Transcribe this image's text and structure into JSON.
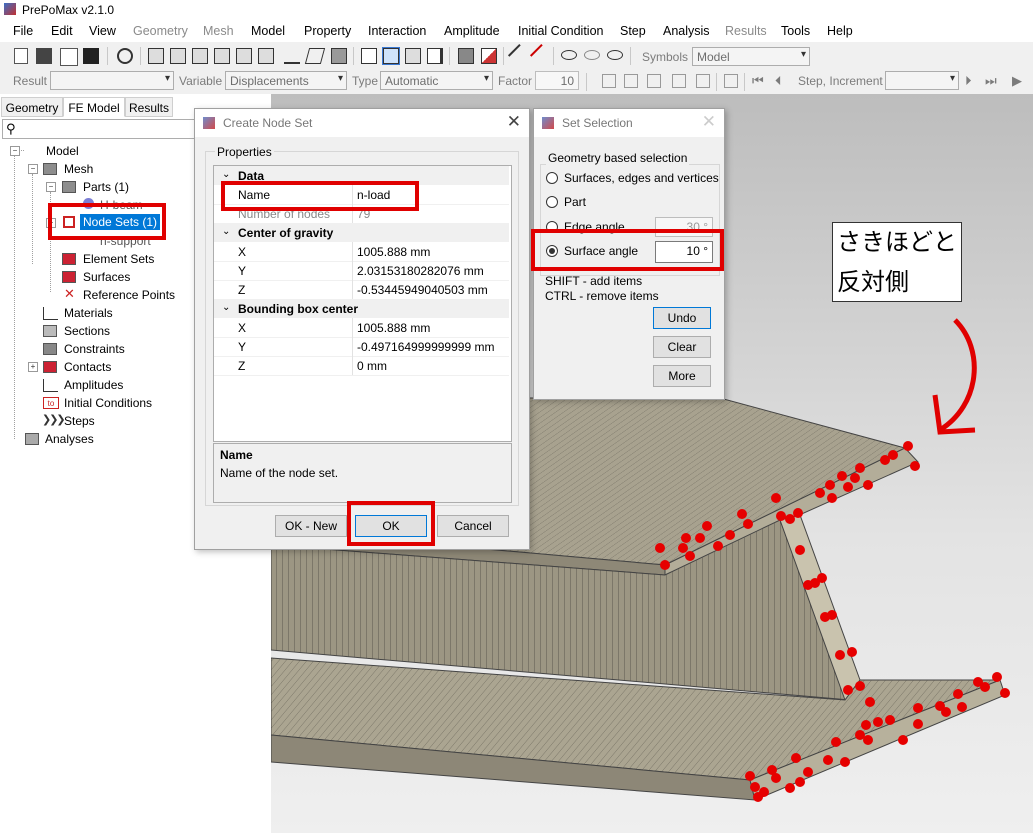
{
  "window": {
    "title": "PrePoMax v2.1.0"
  },
  "menu": [
    {
      "label": "File",
      "enabled": true
    },
    {
      "label": "Edit",
      "enabled": true
    },
    {
      "label": "View",
      "enabled": true
    },
    {
      "label": "Geometry",
      "enabled": false
    },
    {
      "label": "Mesh",
      "enabled": false
    },
    {
      "label": "Model",
      "enabled": true
    },
    {
      "label": "Property",
      "enabled": true
    },
    {
      "label": "Interaction",
      "enabled": true
    },
    {
      "label": "Amplitude",
      "enabled": true
    },
    {
      "label": "Initial Condition",
      "enabled": true
    },
    {
      "label": "Step",
      "enabled": true
    },
    {
      "label": "Analysis",
      "enabled": true
    },
    {
      "label": "Results",
      "enabled": false
    },
    {
      "label": "Tools",
      "enabled": true
    },
    {
      "label": "Help",
      "enabled": true
    }
  ],
  "toolbar1": {
    "symbols_label": "Symbols",
    "symbols_value": "Model"
  },
  "toolbar2": {
    "result_label": "Result",
    "result_value": "",
    "variable_label": "Variable",
    "variable_value": "Displacements",
    "type_label": "Type",
    "type_value": "Automatic",
    "factor_label": "Factor",
    "factor_value": "10",
    "step_label": "Step, Increment",
    "step_value": ""
  },
  "left_panel": {
    "tabs": [
      {
        "label": "Geometry",
        "active": false
      },
      {
        "label": "FE Model",
        "active": true
      },
      {
        "label": "Results",
        "active": false
      }
    ],
    "tree": {
      "model": "Model",
      "mesh": "Mesh",
      "parts": "Parts (1)",
      "hbeam": "H-beam",
      "node_sets": "Node Sets (1)",
      "n_support": "n-support",
      "element_sets": "Element Sets",
      "surfaces": "Surfaces",
      "reference_points": "Reference Points",
      "materials": "Materials",
      "sections": "Sections",
      "constraints": "Constraints",
      "contacts": "Contacts",
      "amplitudes": "Amplitudes",
      "initial_conditions": "Initial Conditions",
      "initial_conditions_icon_text": "to",
      "steps": "Steps",
      "analyses": "Analyses"
    }
  },
  "create_node_set": {
    "title": "Create Node Set",
    "group_label": "Properties",
    "cat_data": "Data",
    "name_label": "Name",
    "name_value": "n-load",
    "num_nodes_label": "Number of nodes",
    "num_nodes_value": "79",
    "cat_cog": "Center of gravity",
    "cog": [
      {
        "axis": "X",
        "value": "1005.888 mm"
      },
      {
        "axis": "Y",
        "value": "2.03153180282076 mm"
      },
      {
        "axis": "Z",
        "value": "-0.53445949040503 mm"
      }
    ],
    "cat_bbox": "Bounding box center",
    "bbox": [
      {
        "axis": "X",
        "value": "1005.888 mm"
      },
      {
        "axis": "Y",
        "value": "-0.497164999999999 mm"
      },
      {
        "axis": "Z",
        "value": "0 mm"
      }
    ],
    "desc_title": "Name",
    "desc_text": "Name of the node set.",
    "btn_ok_new": "OK - New",
    "btn_ok": "OK",
    "btn_cancel": "Cancel"
  },
  "set_selection": {
    "title": "Set Selection",
    "group_label": "Geometry based selection",
    "options": [
      {
        "label": "Surfaces, edges and vertices",
        "checked": false
      },
      {
        "label": "Part",
        "checked": false
      },
      {
        "label": "Edge angle",
        "checked": false,
        "value": "30 °"
      },
      {
        "label": "Surface angle",
        "checked": true,
        "value": "10 °"
      }
    ],
    "hint1": "SHIFT - add items",
    "hint2": "CTRL - remove items",
    "btn_undo": "Undo",
    "btn_clear": "Clear",
    "btn_more": "More"
  },
  "annotation": {
    "line1": "さきほどと",
    "line2": "反対側",
    "color": "#e00000"
  },
  "colors": {
    "highlight_box": "#e00000",
    "selection_blue": "#0078d7",
    "beam_face": "#a8a28f",
    "node_point": "#e60000"
  }
}
